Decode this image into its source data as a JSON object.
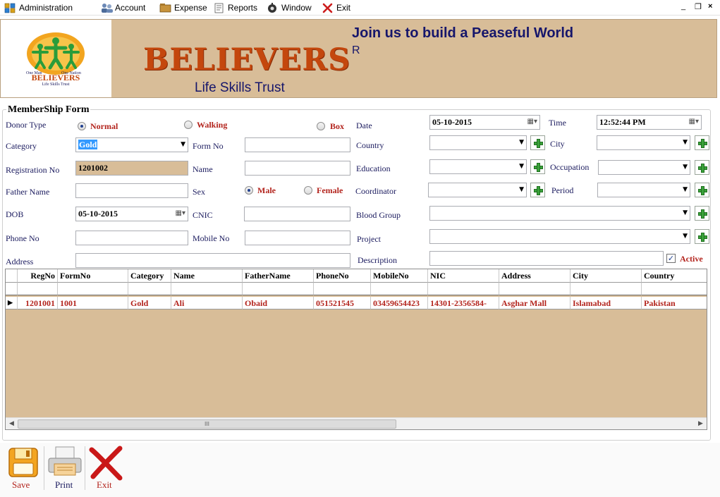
{
  "menu": {
    "items": [
      {
        "label": "Administration",
        "icon": "administration-icon"
      },
      {
        "label": "Account",
        "icon": "account-icon"
      },
      {
        "label": "Expense",
        "icon": "expense-icon"
      },
      {
        "label": "Reports",
        "icon": "reports-icon"
      },
      {
        "label": "Window",
        "icon": "window-icon"
      },
      {
        "label": "Exit",
        "icon": "exit-icon"
      }
    ],
    "window_controls": {
      "minimize": "_",
      "restore": "❐",
      "close": "×"
    }
  },
  "banner": {
    "brand": "BELIEVERS",
    "registered_mark": "R",
    "tagline": "Join us to build a Peaseful World",
    "subtitle": "Life Skills Trust",
    "logo": {
      "top_left": "One Man",
      "top_right": "One Nation",
      "name": "BELIEVERS",
      "sub": "Life Skills Trust"
    }
  },
  "form": {
    "title": "MemberShip Form",
    "labels": {
      "donor_type": "Donor Type",
      "category": "Category",
      "registration_no": "Registration No",
      "father_name": "Father Name",
      "dob": "DOB",
      "phone_no": "Phone No",
      "address": "Address",
      "form_no": "Form No",
      "name": "Name",
      "sex": "Sex",
      "cnic": "CNIC",
      "mobile_no": "Mobile No",
      "date": "Date",
      "country": "Country",
      "education": "Education",
      "coordinator": "Coordinator",
      "blood_group": "Blood Group",
      "project": "Project",
      "description": "Description",
      "time": "Time",
      "city": "City",
      "occupation": "Occupation",
      "period": "Period",
      "active": "Active"
    },
    "donor_type_options": [
      "Normal",
      "Walking",
      "Box"
    ],
    "sex_options": [
      "Male",
      "Female"
    ],
    "values": {
      "category": "Gold",
      "registration_no": "1201002",
      "dob": "05-10-2015",
      "date": "05-10-2015",
      "time": "12:52:44 PM",
      "active_checked": "✓"
    }
  },
  "grid": {
    "columns": [
      "RegNo",
      "FormNo",
      "Category",
      "Name",
      "FatherName",
      "PhoneNo",
      "MobileNo",
      "NIC",
      "Address",
      "City",
      "Country"
    ],
    "rows": [
      [
        "1201001",
        "1001",
        "Gold",
        "Ali",
        "Obaid",
        "051521545",
        "03459654423",
        "14301-2356584-",
        "Asghar Mall",
        "Islamabad",
        "Pakistan"
      ]
    ],
    "row_indicator": "▶",
    "scroll_thumb": "III"
  },
  "toolbar": {
    "save_label": "Save",
    "print_label": "Print",
    "exit_label": "Exit"
  },
  "colors": {
    "banner_bg": "#d8bd98",
    "brand": "#c4470d",
    "label_text": "#1a1a5e",
    "accent_red": "#b3241d"
  }
}
